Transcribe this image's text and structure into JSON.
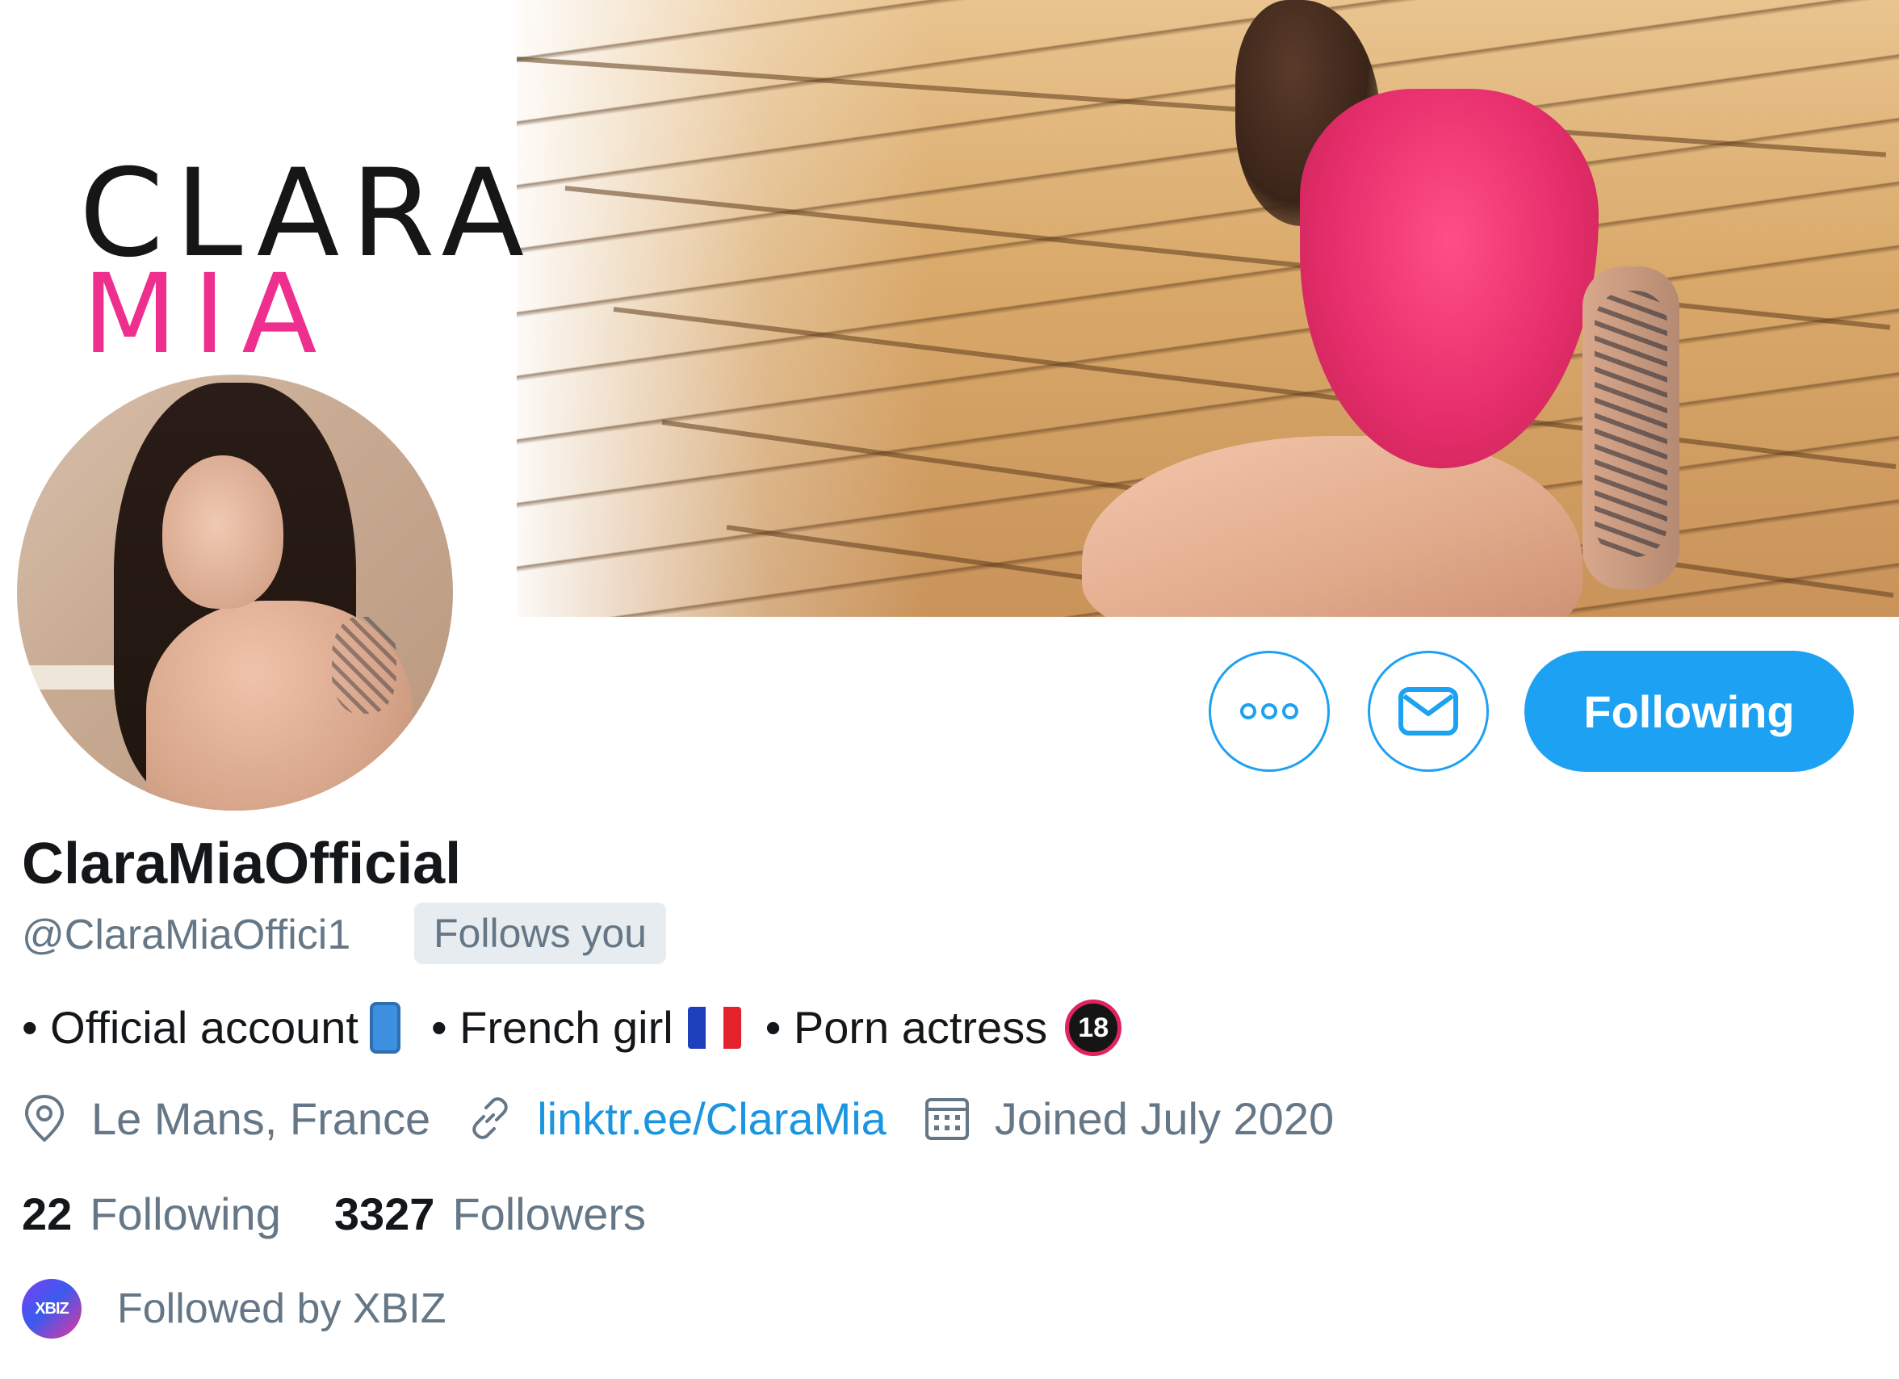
{
  "banner": {
    "logo_line1": "CLARA",
    "logo_line2": "MIA",
    "logo_accent_color": "#ee2f8e"
  },
  "actions": {
    "more_icon": "more-horizontal-icon",
    "message_icon": "envelope-icon",
    "follow_label": "Following",
    "accent_color": "#1da1f2"
  },
  "profile": {
    "display_name": "ClaraMiaOfficial",
    "handle": "@ClaraMiaOffici1",
    "follows_you": "Follows you",
    "bio": {
      "part1": "• Official account",
      "part2": "• French girl",
      "part3": "• Porn actress",
      "badge_18": "18"
    },
    "location": "Le Mans, France",
    "website": "linktr.ee/ClaraMia",
    "joined": "Joined July 2020",
    "following_count": "22",
    "following_label": "Following",
    "followers_count": "3327",
    "followers_label": "Followers",
    "followed_by": "Followed by XBIZ",
    "followed_by_avatar_text": "XBIZ"
  }
}
